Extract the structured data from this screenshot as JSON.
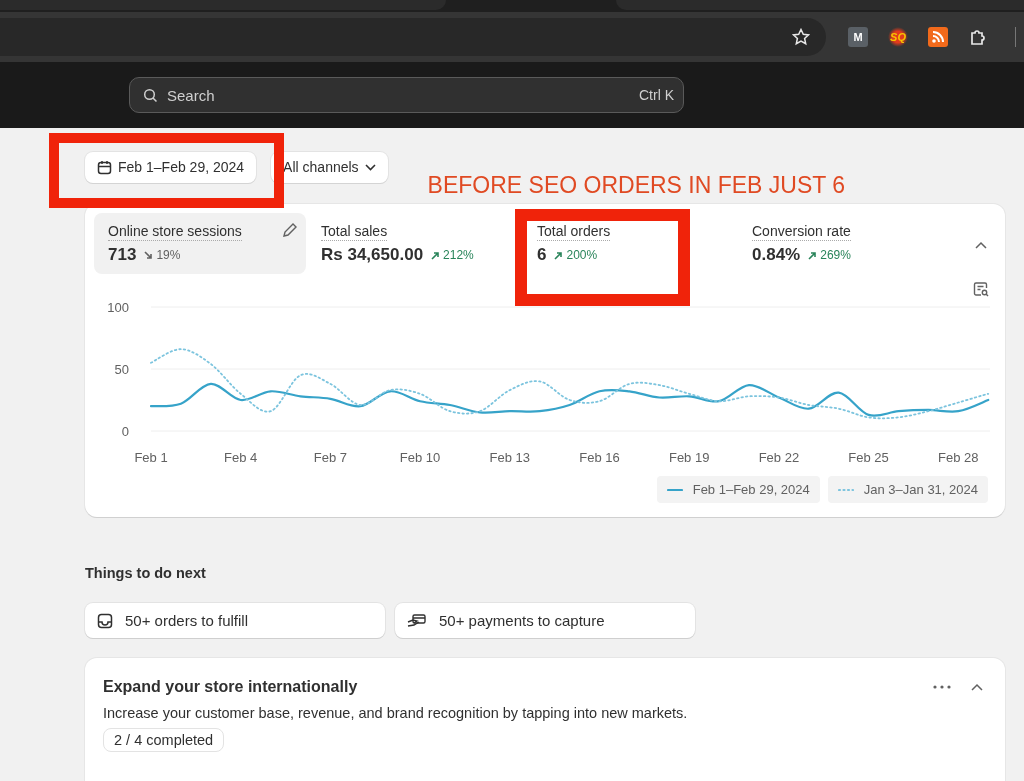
{
  "browser": {
    "extensions": [
      {
        "label": "M",
        "kind": "letter"
      },
      {
        "label": "SQ",
        "kind": "splash"
      },
      {
        "kind": "feed"
      },
      {
        "kind": "puzzle"
      }
    ]
  },
  "topbar": {
    "search": {
      "placeholder": "Search",
      "shortcut": "Ctrl K"
    }
  },
  "filters": [
    {
      "label": "Feb 1–Feb 29, 2024",
      "kind": "date"
    },
    {
      "label": "All channels",
      "kind": "dropdown"
    }
  ],
  "annotation": {
    "text": "BEFORE SEO ORDERS IN  FEB JUST 6"
  },
  "metrics": [
    {
      "label": "Online store sessions",
      "value": "713",
      "change": "19%",
      "kind": "decrease",
      "selected": true
    },
    {
      "label": "Total sales",
      "value": "Rs 34,650.00",
      "change": "212%",
      "kind": "increase",
      "selected": false
    },
    {
      "label": "Total orders",
      "value": "6",
      "change": "200%",
      "kind": "increase",
      "selected": false
    },
    {
      "label": "Conversion rate",
      "value": "0.84%",
      "change": "269%",
      "kind": "increase",
      "selected": false
    }
  ],
  "chart_data": {
    "type": "line",
    "categories": [
      "Feb 1",
      null,
      null,
      "Feb 4",
      null,
      null,
      "Feb 7",
      null,
      null,
      "Feb 10",
      null,
      null,
      "Feb 13",
      null,
      null,
      "Feb 16",
      null,
      null,
      "Feb 19",
      null,
      null,
      "Feb 22",
      null,
      null,
      "Feb 25",
      null,
      null,
      "Feb 28",
      null
    ],
    "ylim": [
      0,
      100
    ],
    "yticks": [
      0,
      50,
      100
    ],
    "series": [
      {
        "name": "Feb 1–Feb 29, 2024",
        "color": "#36a3c9",
        "line_style": "solid",
        "values": [
          20,
          22,
          38,
          25,
          32,
          28,
          26,
          20,
          32,
          24,
          21,
          15,
          16,
          16,
          21,
          32,
          32,
          27,
          28,
          24,
          37,
          27,
          18,
          31,
          13,
          16,
          17,
          16,
          25
        ]
      },
      {
        "name": "Jan 3–Jan 31, 2024",
        "color": "#7cc4de",
        "line_style": "dotted",
        "values": [
          55,
          66,
          54,
          30,
          16,
          45,
          38,
          21,
          33,
          30,
          16,
          16,
          33,
          40,
          25,
          24,
          38,
          37,
          30,
          24,
          28,
          27,
          21,
          18,
          11,
          11,
          16,
          23,
          30
        ]
      }
    ]
  },
  "todo": {
    "title": "Things to do next",
    "items": [
      {
        "label": "50+ orders to fulfill",
        "kind": "inbox"
      },
      {
        "label": "50+ payments to capture",
        "kind": "payment"
      }
    ]
  },
  "setup_card": {
    "title": "Expand your store internationally",
    "description": "Increase your customer base, revenue, and brand recognition by tapping into new markets.",
    "progress": "2 / 4 completed",
    "expanded": true
  }
}
